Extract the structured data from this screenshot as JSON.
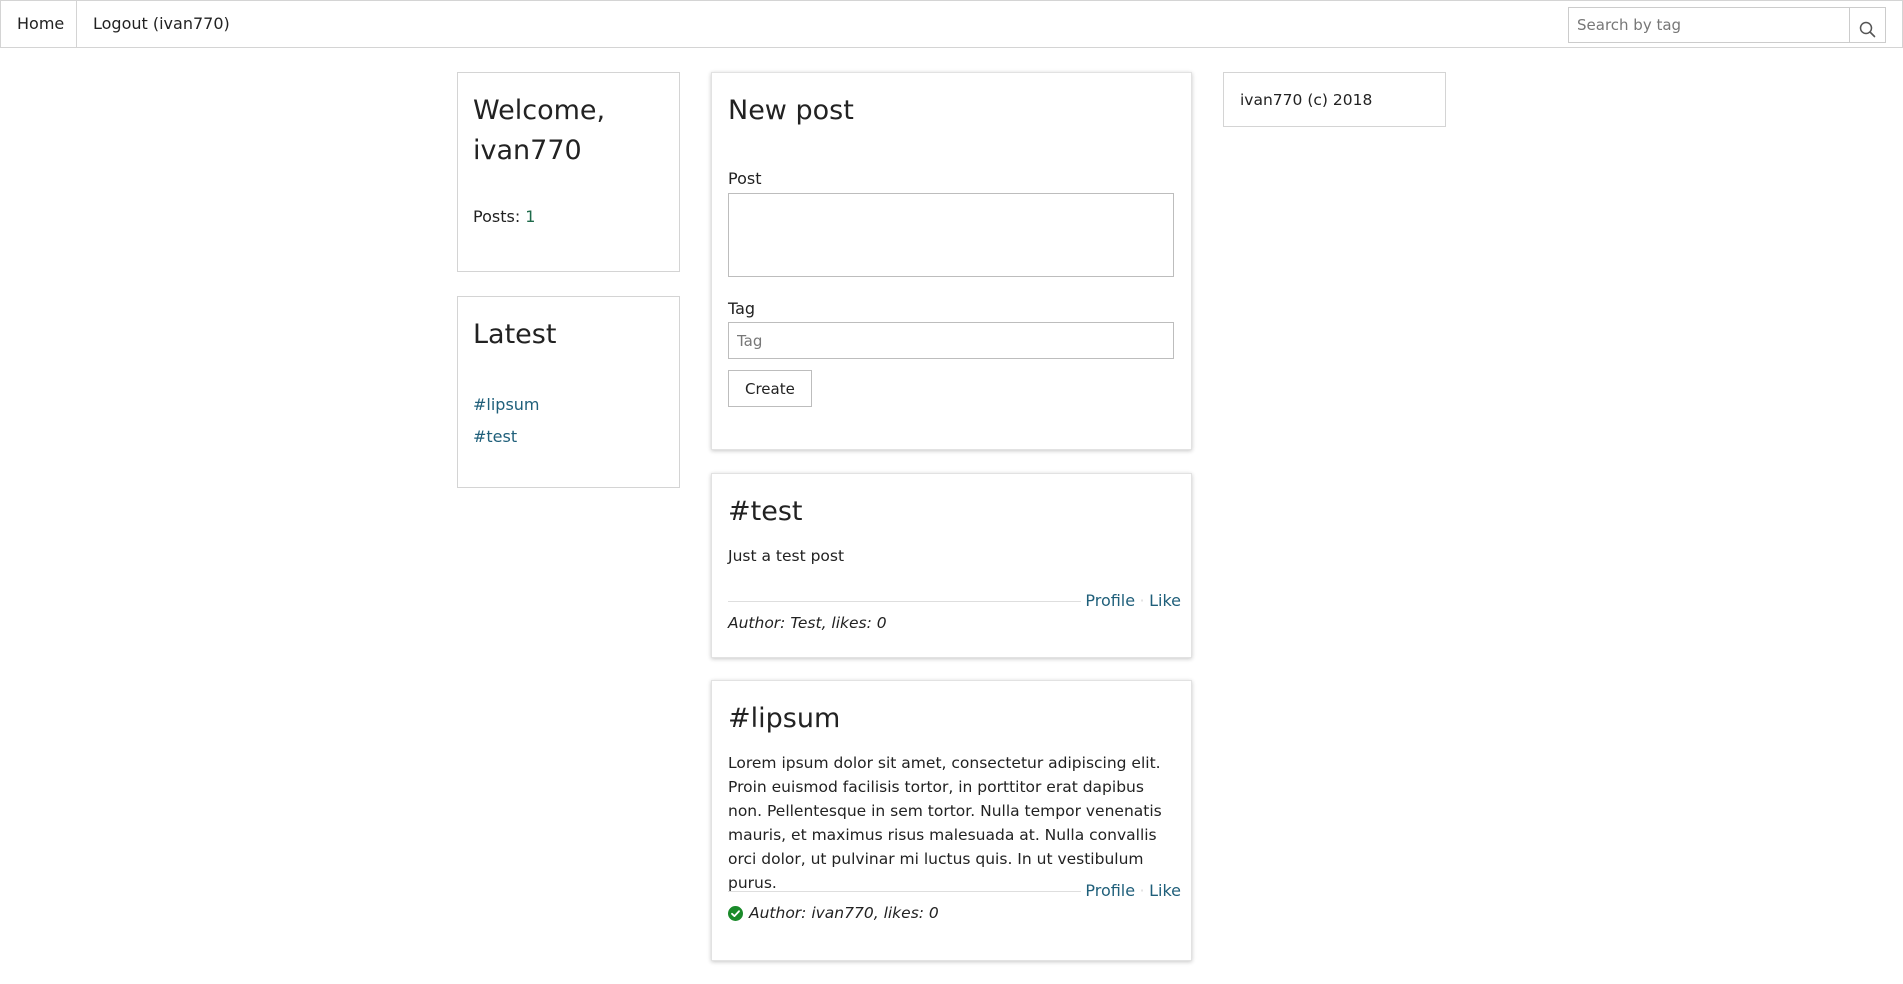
{
  "navbar": {
    "home_label": "Home",
    "logout_label": "Logout (ivan770)",
    "search_placeholder": "Search by tag"
  },
  "welcome": {
    "title": "Welcome, ivan770",
    "posts_label": "Posts: ",
    "posts_count": "1"
  },
  "latest": {
    "title": "Latest",
    "tags": [
      "#lipsum",
      "#test"
    ]
  },
  "new_post": {
    "title": "New post",
    "post_label": "Post",
    "post_value": "",
    "tag_label": "Tag",
    "tag_placeholder": "Tag",
    "create_label": "Create"
  },
  "posts": [
    {
      "tag": "#test",
      "body": "Just a test post",
      "profile_label": "Profile",
      "like_label": "Like",
      "author_line": "Author: Test, likes: 0",
      "verified": false
    },
    {
      "tag": "#lipsum",
      "body": "Lorem ipsum dolor sit amet, consectetur adipiscing elit. Proin euismod facilisis tortor, in porttitor erat dapibus non. Pellentesque in sem tortor. Nulla tempor venenatis mauris, et maximus risus malesuada at. Nulla convallis orci dolor, ut pulvinar mi luctus quis. In ut vestibulum purus.",
      "profile_label": "Profile",
      "like_label": "Like",
      "author_line": "Author: ivan770, likes: 0",
      "verified": true,
      "verified_icon": "check-circle-icon"
    }
  ],
  "footer": {
    "text": "ivan770 (c) 2018"
  },
  "colors": {
    "link": "#1f5f7a",
    "border": "#d4d4d4",
    "verified": "#1a8a2a"
  }
}
